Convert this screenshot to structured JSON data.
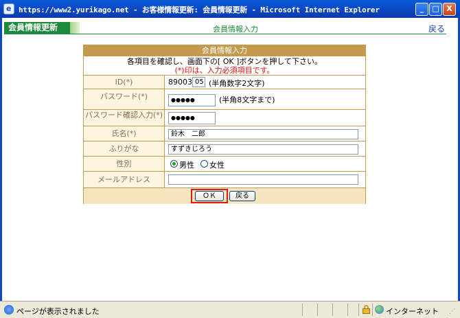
{
  "window": {
    "title": "https://www2.yurikago.net - お客様情報更新: 会員情報更新 - Microsoft Internet Explorer",
    "minimize_label": "_",
    "maximize_label": "□",
    "close_label": "X"
  },
  "header": {
    "tag": "会員情報更新",
    "title": "会員情報入力",
    "back_link": "戻る"
  },
  "form": {
    "caption": "会員情報入力",
    "instruction": "各項目を確認し、画面下の[ OK ]ボタンを押して下さい。",
    "required_note": "(*)印は、入力必須項目です。",
    "fields": {
      "id": {
        "label": "ID(*)",
        "prefix": "890031",
        "value": "05",
        "note": "(半角数字2文字)"
      },
      "password": {
        "label": "パスワード(*)",
        "value": "●●●●●",
        "note": "(半角8文字まで)"
      },
      "password_confirm": {
        "label": "パスワード確認入力(*)",
        "value": "●●●●●"
      },
      "name": {
        "label": "氏名(*)",
        "value": "鈴木　二郎"
      },
      "furigana": {
        "label": "ふりがな",
        "value": "すずきじろう"
      },
      "gender": {
        "label": "性別",
        "options": [
          "男性",
          "女性"
        ],
        "selected": "男性"
      },
      "email": {
        "label": "メールアドレス",
        "value": ""
      }
    },
    "ok_button": "ＯＫ",
    "back_button": "戻る"
  },
  "statusbar": {
    "message": "ページが表示されました",
    "zone": "インターネット"
  },
  "colors": {
    "form_border": "#c59a4d",
    "label_bg": "#fdf5e0",
    "header_green": "#1a8a3c",
    "highlight_red": "#e01818"
  }
}
